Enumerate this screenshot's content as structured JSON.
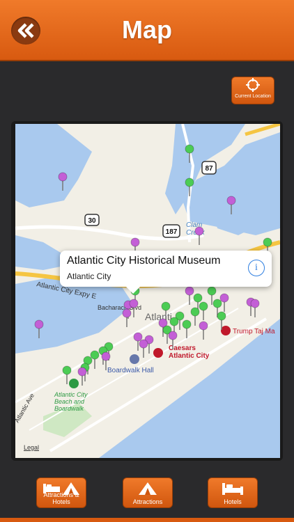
{
  "header": {
    "title": "Map",
    "back_icon": "double-chevron-left-icon"
  },
  "location_button": {
    "label": "Current Location",
    "icon": "crosshair-icon"
  },
  "map": {
    "labels": {
      "clam_creek": "Clam\nCreek",
      "expressway": "Atlantic City Expy E",
      "bachar": "Bacharach Blvd",
      "ave": "Atlantic Ave",
      "city": "Atlanti",
      "trump": "Trump Taj Ma",
      "caesars": "Caesars\nAtlantic City",
      "boardwalk_hall": "Boardwalk Hall",
      "beach": "Atlantic City\nBeach and\nBoardwalk",
      "route_87": "87",
      "route_30": "30",
      "route_187": "187"
    },
    "legal": "Legal"
  },
  "callout": {
    "title": "Atlantic City Historical Museum",
    "subtitle": "Atlantic City",
    "info_icon": "info-icon"
  },
  "bottom_nav": [
    {
      "label": "Attractions & Hotels",
      "icon": "bed-tent-icon"
    },
    {
      "label": "Attractions",
      "icon": "tent-icon"
    },
    {
      "label": "Hotels",
      "icon": "bed-icon"
    }
  ],
  "colors": {
    "accent": "#e8671c",
    "water": "#a9c9ee",
    "land": "#f2efe6",
    "pin_green": "#4ccc54",
    "pin_purple": "#c35fd6"
  }
}
